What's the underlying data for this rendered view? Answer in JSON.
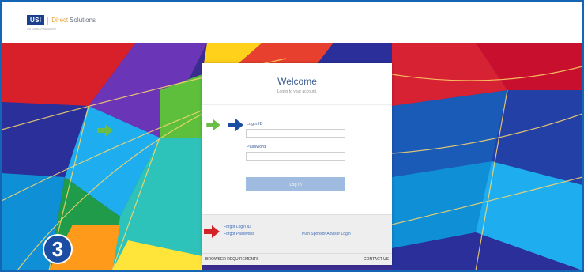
{
  "header": {
    "logo_brand": "USI",
    "logo_product_1": "Direct",
    "logo_product_2": "Solutions",
    "logo_tagline": "USI CONSULTING GROUP"
  },
  "login": {
    "title": "Welcome",
    "subtitle": "Log in to your account.",
    "login_id_label": "Login ID",
    "login_id_value": "",
    "password_label": "Password",
    "password_value": "",
    "submit_label": "Log In",
    "forgot_login_label": "Forgot Login ID",
    "forgot_password_label": "Forgot Password",
    "sponsor_login_label": "Plan Sponsor/Advisor Login"
  },
  "footer": {
    "browser_label": "BROWSER REQUIREMENTS",
    "contact_label": "CONTACT US"
  },
  "annotation": {
    "step_number": "3",
    "arrow_colors": {
      "green": "#6abd45",
      "blue": "#1b4ea3",
      "red": "#d2232a"
    }
  },
  "colors": {
    "frame_border": "#1565b5",
    "accent_blue": "#3d5e92",
    "login_button": "#9fbbe0"
  }
}
